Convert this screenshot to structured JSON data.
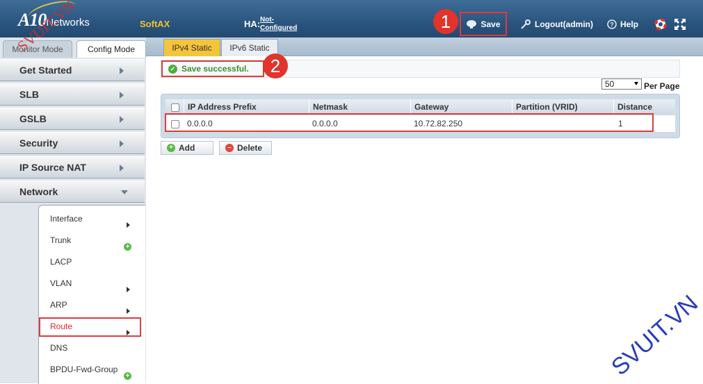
{
  "header": {
    "logo_main": "A10",
    "logo_sub": "Networks",
    "product": "SoftAX",
    "ha_label": "HA:",
    "ha_status": "Not-Configured",
    "save_label": "Save",
    "logout_label": "Logout(admin)",
    "help_label": "Help"
  },
  "annotations": {
    "step1": "1",
    "step2": "2"
  },
  "left_panel": {
    "mode_tabs": {
      "monitor": "Monitor Mode",
      "config": "Config Mode"
    },
    "nav": [
      "Get Started",
      "SLB",
      "GSLB",
      "Security",
      "IP Source NAT",
      "Network"
    ],
    "network_items": [
      "Interface",
      "Trunk",
      "LACP",
      "VLAN",
      "ARP",
      "Route",
      "DNS",
      "BPDU-Fwd-Group"
    ]
  },
  "main": {
    "tabs": [
      "IPv4 Static",
      "IPv6 Static"
    ],
    "status": "Save successful.",
    "per_page_value": "50",
    "per_page_label": "Per Page",
    "columns": [
      "IP Address Prefix",
      "Netmask",
      "Gateway",
      "Partition (VRID)",
      "Distance"
    ],
    "rows": [
      {
        "prefix": "0.0.0.0",
        "netmask": "0.0.0.0",
        "gateway": "10.72.82.250",
        "partition": "",
        "distance": "1"
      }
    ],
    "add_label": "Add",
    "delete_label": "Delete"
  },
  "watermarks": {
    "left": "SVUIT.VN",
    "right": "SVUIT.VN"
  },
  "colors": {
    "header": "#2a557f",
    "accent_tab": "#f4c43a",
    "highlight": "#e03b3b",
    "success": "#3a8f2d"
  }
}
